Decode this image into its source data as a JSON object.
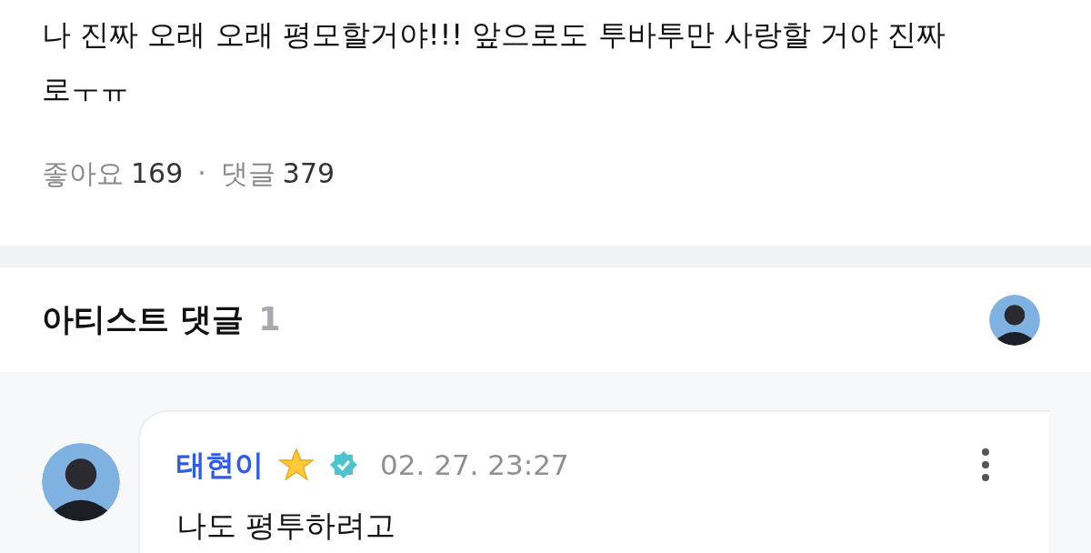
{
  "post": {
    "text": "나 진짜 오래 오래 평모할거야!!! 앞으로도 투바투만 사랑할 거야 진짜로ㅜㅠ"
  },
  "stats": {
    "likes_label": "좋아요",
    "likes": "169",
    "separator": "·",
    "comments_label": "댓글",
    "comments": "379"
  },
  "artist_comments": {
    "title": "아티스트 댓글",
    "count": "1"
  },
  "comments": [
    {
      "author": "태현이",
      "verified": true,
      "time": "02. 27. 23:27",
      "text": "나도 평투하려고"
    }
  ]
}
